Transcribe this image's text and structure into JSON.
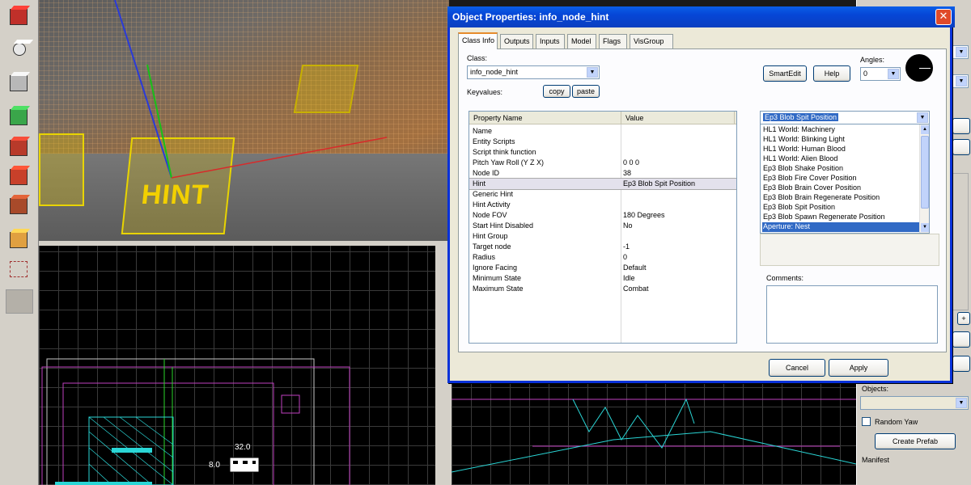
{
  "dialog": {
    "title": "Object Properties: info_node_hint",
    "close_glyph": "✕",
    "tabs": [
      "Class Info",
      "Outputs",
      "Inputs",
      "Model",
      "Flags",
      "VisGroup"
    ],
    "class_label": "Class:",
    "class_value": "info_node_hint",
    "keyvalues_label": "Keyvalues:",
    "copy_label": "copy",
    "paste_label": "paste",
    "smartedit_label": "SmartEdit",
    "help_label": "Help",
    "angles_label": "Angles:",
    "angles_value": "0",
    "table_headers": [
      "Property Name",
      "Value"
    ],
    "properties": [
      {
        "name": "Name",
        "value": ""
      },
      {
        "name": "Entity Scripts",
        "value": ""
      },
      {
        "name": "Script think function",
        "value": ""
      },
      {
        "name": "Pitch Yaw Roll (Y Z X)",
        "value": "0 0 0"
      },
      {
        "name": "Node ID",
        "value": "38"
      },
      {
        "name": "Hint",
        "value": "Ep3 Blob Spit Position"
      },
      {
        "name": "Generic Hint",
        "value": ""
      },
      {
        "name": "Hint Activity",
        "value": ""
      },
      {
        "name": "Node FOV",
        "value": "180 Degrees"
      },
      {
        "name": "Start Hint Disabled",
        "value": "No"
      },
      {
        "name": "Hint Group",
        "value": ""
      },
      {
        "name": "Target node",
        "value": "-1"
      },
      {
        "name": "Radius",
        "value": "0"
      },
      {
        "name": "Ignore Facing",
        "value": "Default"
      },
      {
        "name": "Minimum State",
        "value": "Idle"
      },
      {
        "name": "Maximum State",
        "value": "Combat"
      }
    ],
    "selected_property_index": 5,
    "hint_combo_value": "Ep3 Blob Spit Position",
    "hint_options": [
      "HL1 World: Machinery",
      "HL1 World: Blinking Light",
      "HL1 World: Human Blood",
      "HL1 World: Alien Blood",
      "Ep3 Blob Shake Position",
      "Ep3 Blob Fire Cover Position",
      "Ep3 Blob Brain Cover Position",
      "Ep3 Blob Brain Regenerate Position",
      "Ep3 Blob Spit Position",
      "Ep3 Blob Spawn Regenerate Position",
      "Aperture: Nest"
    ],
    "selected_option_index": 10,
    "comments_label": "Comments:",
    "cancel_label": "Cancel",
    "apply_label": "Apply"
  },
  "viewport3d": {
    "hint_text": "HINT"
  },
  "viewport2d": {
    "dimension_label": "32.0",
    "dimension_label_2": "8.0"
  },
  "right_panel": {
    "objects_label": "Objects:",
    "random_yaw_label": "Random Yaw",
    "create_prefab_label": "Create Prefab",
    "manifest_label": "Manifest",
    "plus_glyph": "+",
    "up_glyph": "▲",
    "down_glyph": "▼"
  },
  "colors": {
    "xp_blue": "#0831d9",
    "selection": "#316ac5",
    "hint_yellow": "#e8d400",
    "wire_cyan": "#2ad6d6",
    "wire_magenta": "#c040c0"
  }
}
